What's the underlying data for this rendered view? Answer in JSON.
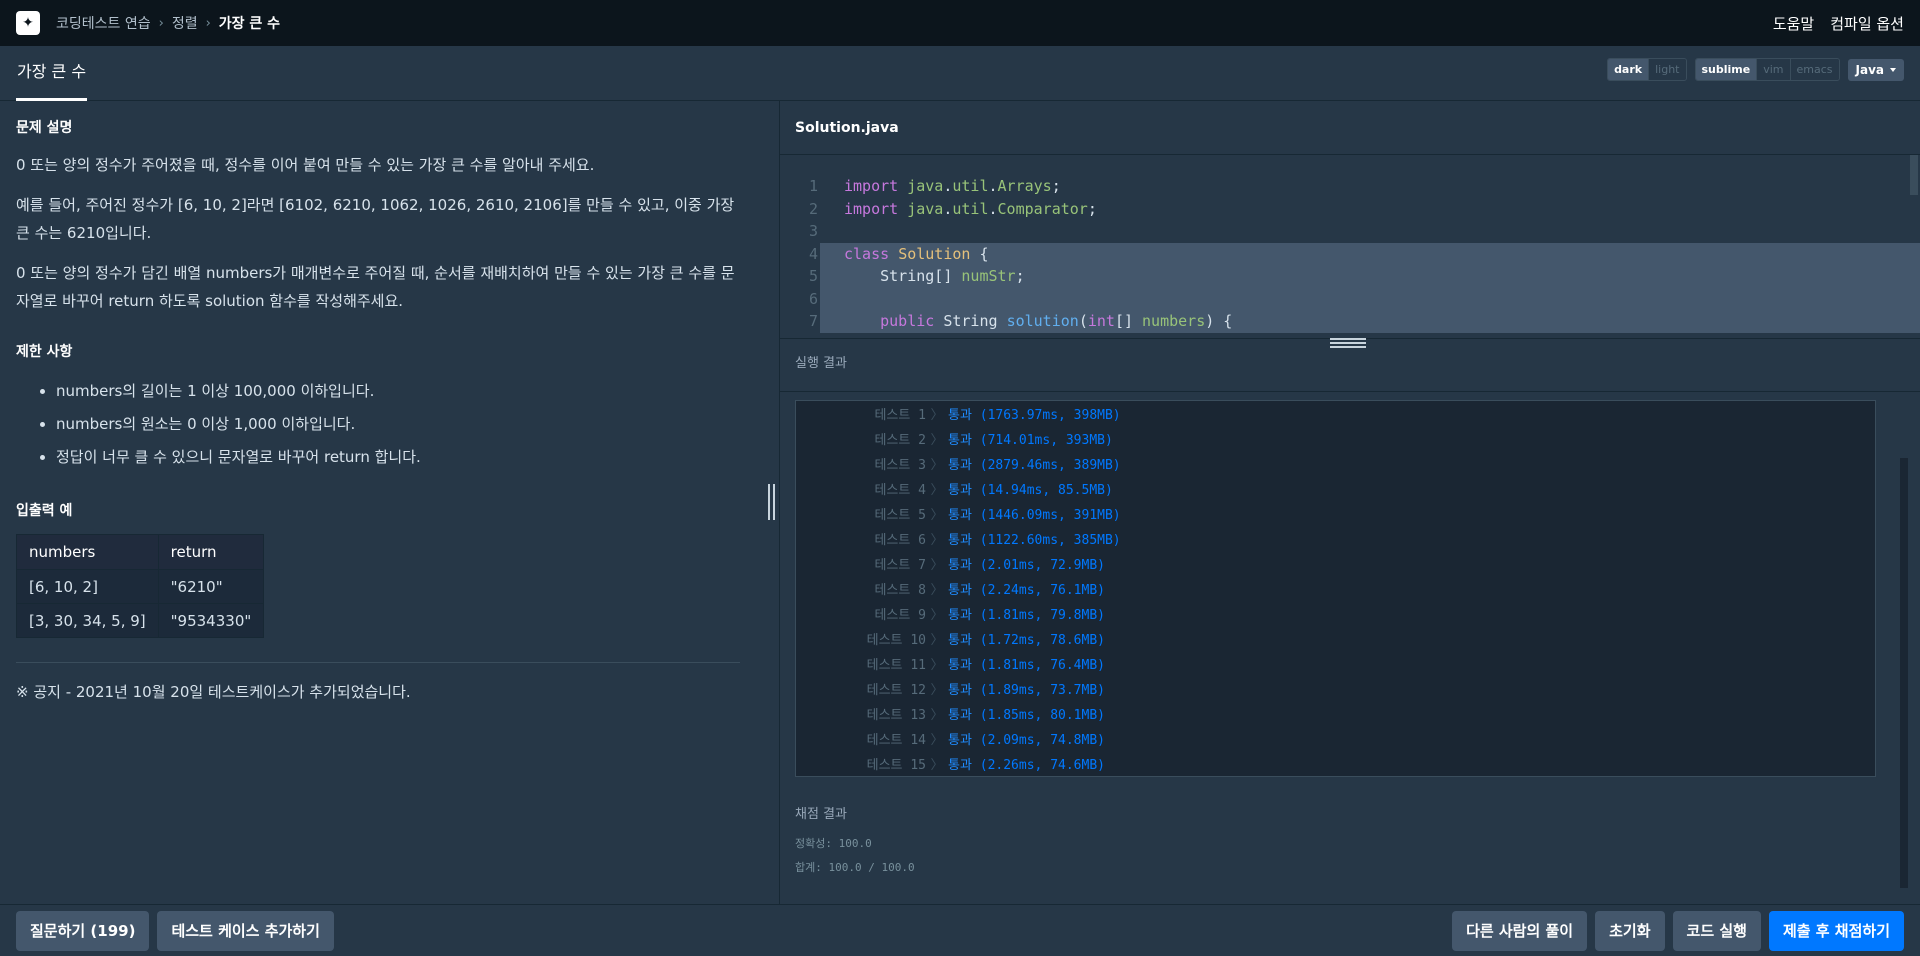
{
  "nav": {
    "breadcrumb": [
      "코딩테스트 연습",
      "정렬",
      "가장 큰 수"
    ],
    "help": "도움말",
    "compile_options": "컴파일 옵션"
  },
  "tabbar": {
    "title": "가장 큰 수",
    "themes": [
      "dark",
      "light"
    ],
    "keymaps": [
      "sublime",
      "vim",
      "emacs"
    ],
    "language": "Java"
  },
  "problem": {
    "section_title": "문제 설명",
    "p1": "0 또는 양의 정수가 주어졌을 때, 정수를 이어 붙여 만들 수 있는 가장 큰 수를 알아내 주세요.",
    "p2": "예를 들어, 주어진 정수가 [6, 10, 2]라면 [6102, 6210, 1062, 1026, 2610, 2106]를 만들 수 있고, 이중 가장 큰 수는 6210입니다.",
    "p3": "0 또는 양의 정수가 담긴 배열 numbers가 매개변수로 주어질 때, 순서를 재배치하여 만들 수 있는 가장 큰 수를 문자열로 바꾸어 return 하도록 solution 함수를 작성해주세요.",
    "limits_title": "제한 사항",
    "limits": [
      "numbers의 길이는 1 이상 100,000 이하입니다.",
      "numbers의 원소는 0 이상 1,000 이하입니다.",
      "정답이 너무 클 수 있으니 문자열로 바꾸어 return 합니다."
    ],
    "io_title": "입출력 예",
    "io_headers": [
      "numbers",
      "return"
    ],
    "io_rows": [
      [
        "[6, 10, 2]",
        "\"6210\""
      ],
      [
        "[3, 30, 34, 5, 9]",
        "\"9534330\""
      ]
    ],
    "notice": "※ 공지 - 2021년 10월 20일 테스트케이스가 추가되었습니다."
  },
  "editor": {
    "filename": "Solution.java",
    "lines": [
      {
        "n": "1",
        "parts": [
          [
            "kw",
            "import "
          ],
          [
            "pkg",
            "java"
          ],
          [
            "",
            "."
          ],
          [
            "pkg",
            "util"
          ],
          [
            "",
            "."
          ],
          [
            "pkg",
            "Arrays"
          ],
          [
            "",
            ";"
          ]
        ]
      },
      {
        "n": "2",
        "parts": [
          [
            "kw",
            "import "
          ],
          [
            "pkg",
            "java"
          ],
          [
            "",
            "."
          ],
          [
            "pkg",
            "util"
          ],
          [
            "",
            "."
          ],
          [
            "pkg",
            "Comparator"
          ],
          [
            "",
            ";"
          ]
        ]
      },
      {
        "n": "3",
        "parts": []
      },
      {
        "n": "4",
        "parts": [
          [
            "kw",
            "class "
          ],
          [
            "cls",
            "Solution"
          ],
          [
            "",
            " {"
          ]
        ]
      },
      {
        "n": "5",
        "parts": [
          [
            "",
            "    String[] "
          ],
          [
            "pkg",
            "numStr"
          ],
          [
            "",
            ";"
          ]
        ]
      },
      {
        "n": "6",
        "parts": []
      },
      {
        "n": "7",
        "parts": [
          [
            "",
            "    "
          ],
          [
            "kw",
            "public "
          ],
          [
            "",
            "String "
          ],
          [
            "fn",
            "solution"
          ],
          [
            "",
            "("
          ],
          [
            "kw",
            "int"
          ],
          [
            "",
            "[] "
          ],
          [
            "pkg",
            "numbers"
          ],
          [
            "",
            ") {"
          ]
        ]
      }
    ]
  },
  "result": {
    "title": "실행 결과",
    "tests": [
      {
        "name": "테스트 1",
        "status": "통과",
        "detail": "(1763.97ms, 398MB)"
      },
      {
        "name": "테스트 2",
        "status": "통과",
        "detail": "(714.01ms, 393MB)"
      },
      {
        "name": "테스트 3",
        "status": "통과",
        "detail": "(2879.46ms, 389MB)"
      },
      {
        "name": "테스트 4",
        "status": "통과",
        "detail": "(14.94ms, 85.5MB)"
      },
      {
        "name": "테스트 5",
        "status": "통과",
        "detail": "(1446.09ms, 391MB)"
      },
      {
        "name": "테스트 6",
        "status": "통과",
        "detail": "(1122.60ms, 385MB)"
      },
      {
        "name": "테스트 7",
        "status": "통과",
        "detail": "(2.01ms, 72.9MB)"
      },
      {
        "name": "테스트 8",
        "status": "통과",
        "detail": "(2.24ms, 76.1MB)"
      },
      {
        "name": "테스트 9",
        "status": "통과",
        "detail": "(1.81ms, 79.8MB)"
      },
      {
        "name": "테스트 10",
        "status": "통과",
        "detail": "(1.72ms, 78.6MB)"
      },
      {
        "name": "테스트 11",
        "status": "통과",
        "detail": "(1.81ms, 76.4MB)"
      },
      {
        "name": "테스트 12",
        "status": "통과",
        "detail": "(1.89ms, 73.7MB)"
      },
      {
        "name": "테스트 13",
        "status": "통과",
        "detail": "(1.85ms, 80.1MB)"
      },
      {
        "name": "테스트 14",
        "status": "통과",
        "detail": "(2.09ms, 74.8MB)"
      },
      {
        "name": "테스트 15",
        "status": "통과",
        "detail": "(2.26ms, 74.6MB)"
      }
    ],
    "score_title": "채점 결과",
    "accuracy": "정확성: 100.0",
    "total": "합계: 100.0 / 100.0"
  },
  "footer": {
    "question": "질문하기 (199)",
    "add_test": "테스트 케이스 추가하기",
    "others": "다른 사람의 풀이",
    "reset": "초기화",
    "run": "코드 실행",
    "submit": "제출 후 채점하기"
  },
  "colors": {
    "background": "#263747",
    "nav": "#0c151c",
    "accent": "#0078ff",
    "button": "#44576c"
  }
}
